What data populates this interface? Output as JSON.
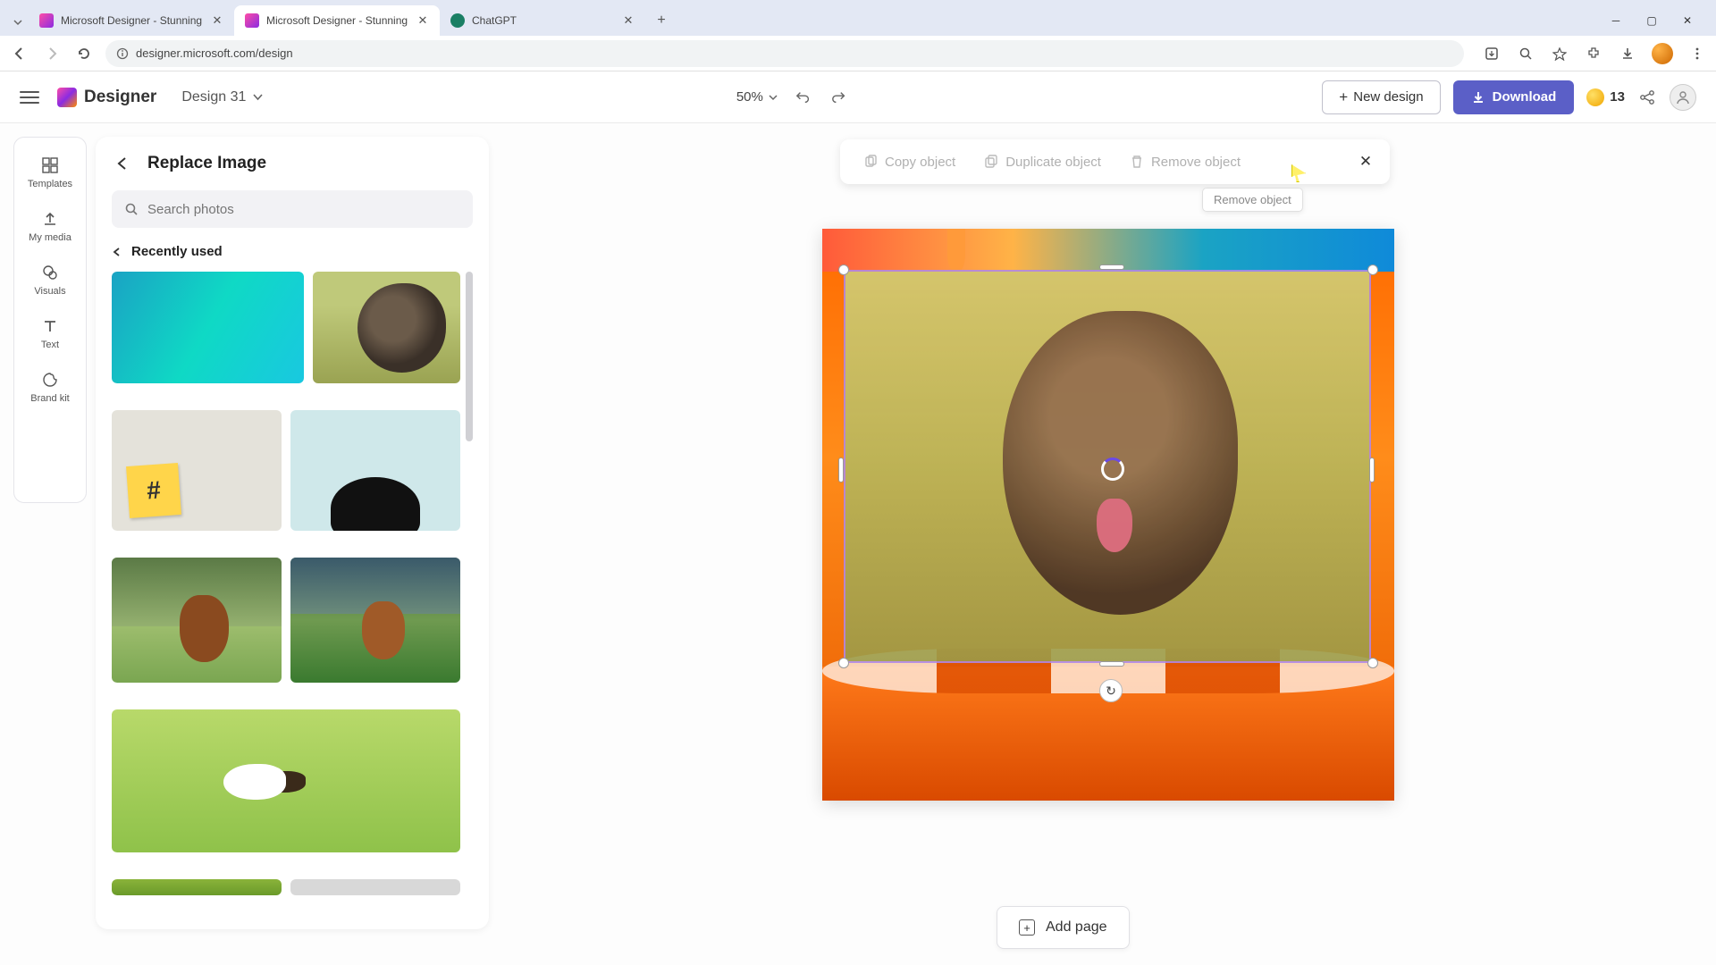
{
  "browser": {
    "tabs": [
      {
        "title": "Microsoft Designer - Stunning",
        "active": false
      },
      {
        "title": "Microsoft Designer - Stunning",
        "active": true
      },
      {
        "title": "ChatGPT",
        "active": false
      }
    ],
    "url": "designer.microsoft.com/design"
  },
  "header": {
    "logo_text": "Designer",
    "design_name": "Design 31",
    "zoom": "50%",
    "new_design": "New design",
    "download": "Download",
    "coins": "13"
  },
  "rail": {
    "templates": "Templates",
    "my_media": "My media",
    "visuals": "Visuals",
    "text": "Text",
    "brand_kit": "Brand kit"
  },
  "panel": {
    "title": "Replace Image",
    "search_placeholder": "Search photos",
    "recent_label": "Recently used"
  },
  "context": {
    "copy": "Copy object",
    "duplicate": "Duplicate object",
    "remove": "Remove object",
    "tooltip": "Remove object"
  },
  "footer": {
    "add_page": "Add page"
  }
}
